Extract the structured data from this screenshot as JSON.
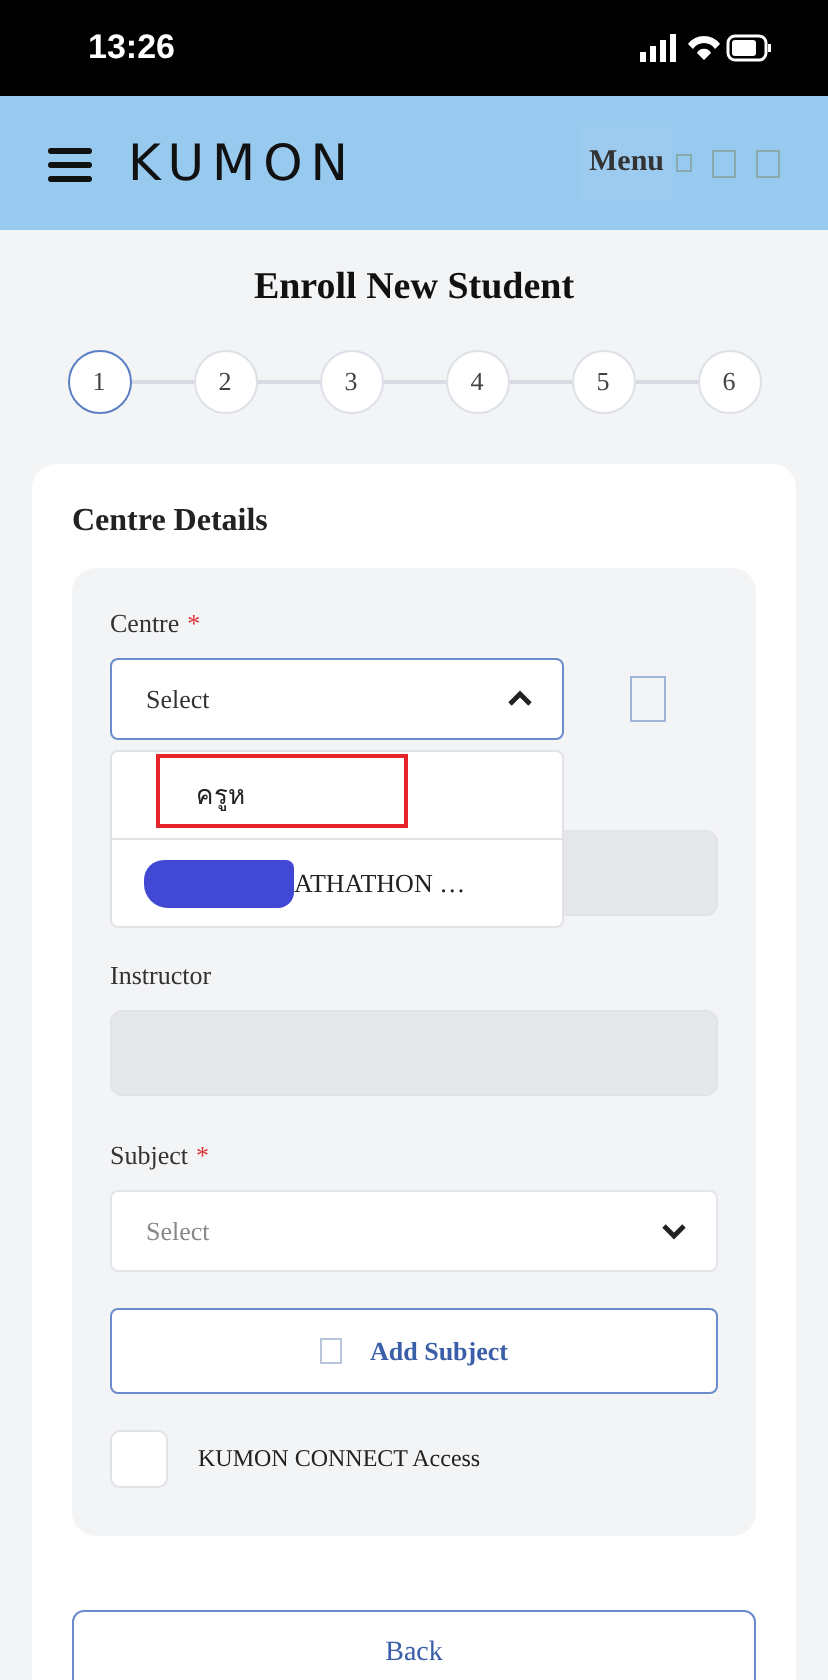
{
  "status_bar": {
    "time": "13:26"
  },
  "header": {
    "logo": "KUMON",
    "menu_label": "Menu"
  },
  "title": "Enroll New Student",
  "steps": [
    {
      "label": "1",
      "selected": true
    },
    {
      "label": "2",
      "selected": false
    },
    {
      "label": "3",
      "selected": false
    },
    {
      "label": "4",
      "selected": false
    },
    {
      "label": "5",
      "selected": false
    },
    {
      "label": "6",
      "selected": false
    }
  ],
  "section_title": "Centre Details",
  "centre": {
    "label": "Centre",
    "required_mark": "*",
    "placeholder": "Select",
    "expanded": true,
    "options": [
      {
        "label": "ครูห",
        "highlighted": true
      },
      {
        "label": "ATHATHON …",
        "redacted": true
      }
    ]
  },
  "hidden_field": {
    "disabled": true
  },
  "instructor": {
    "label": "Instructor",
    "disabled": true
  },
  "subject": {
    "label": "Subject",
    "required_mark": "*",
    "placeholder": "Select",
    "expanded": false
  },
  "add_subject": "Add Subject",
  "connect": {
    "label": "KUMON CONNECT Access",
    "checked": false
  },
  "back": "Back"
}
